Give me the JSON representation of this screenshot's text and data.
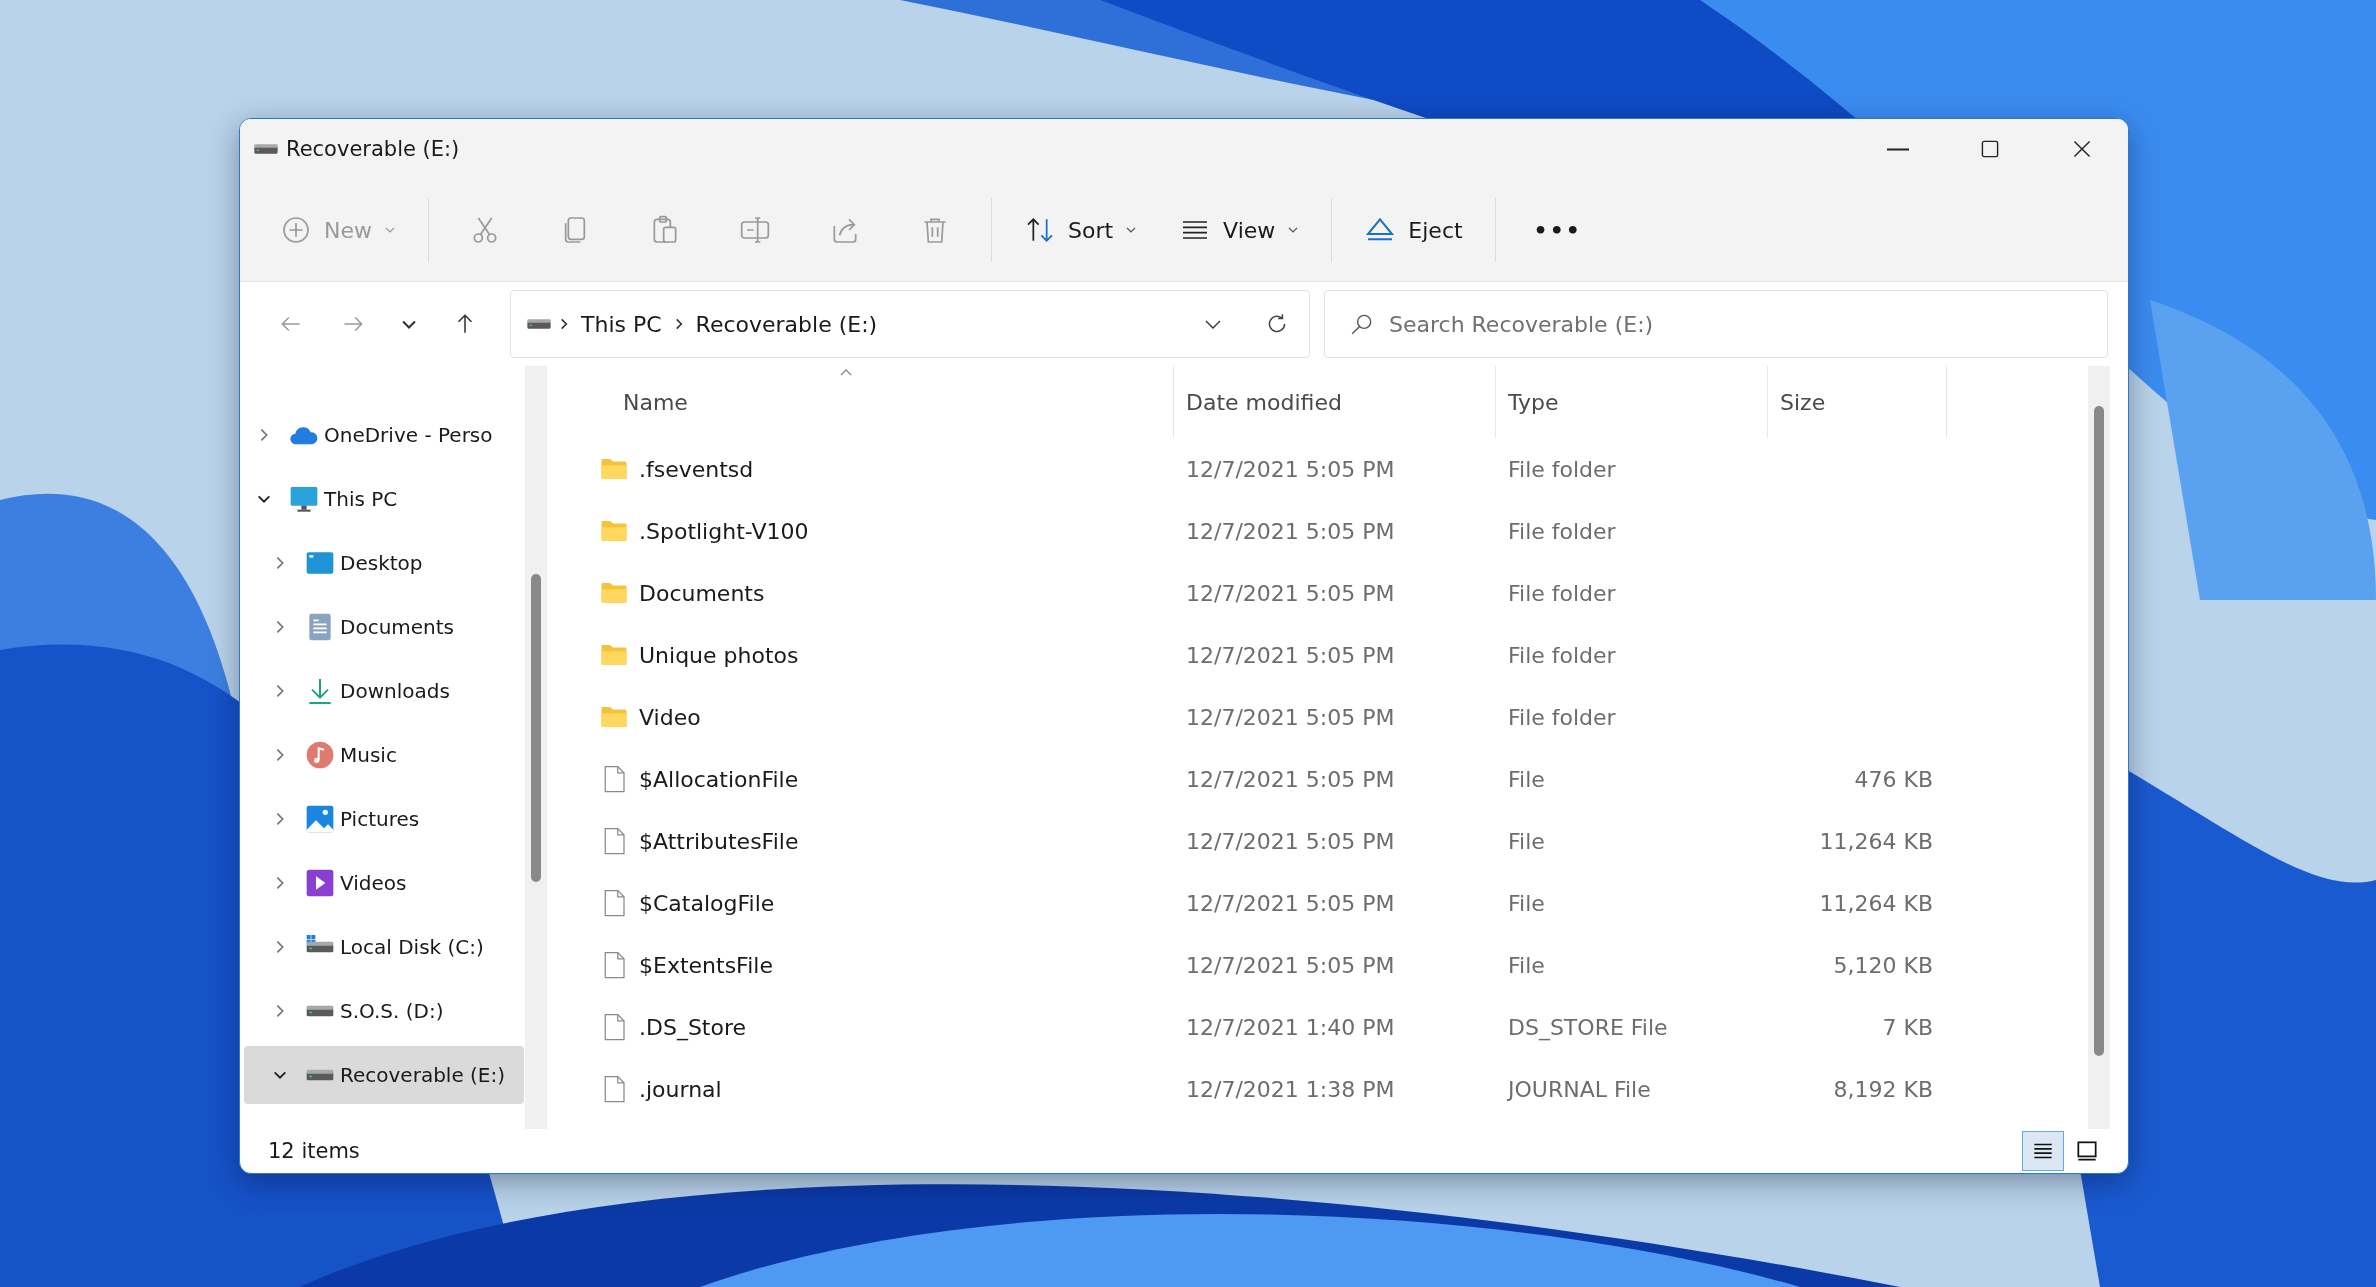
{
  "window": {
    "title": "Recoverable (E:)"
  },
  "toolbar": [
    {
      "kind": "new",
      "label": "New",
      "disabled": true,
      "dropdown": true
    },
    {
      "kind": "separator"
    },
    {
      "kind": "cut",
      "disabled": true
    },
    {
      "kind": "copy",
      "disabled": true
    },
    {
      "kind": "paste",
      "disabled": true
    },
    {
      "kind": "rename",
      "disabled": true
    },
    {
      "kind": "share",
      "disabled": true
    },
    {
      "kind": "delete",
      "disabled": true
    },
    {
      "kind": "separator"
    },
    {
      "kind": "sort",
      "label": "Sort",
      "disabled": false,
      "dropdown": true
    },
    {
      "kind": "view",
      "label": "View",
      "disabled": false,
      "dropdown": true
    },
    {
      "kind": "separator"
    },
    {
      "kind": "eject",
      "label": "Eject",
      "disabled": false,
      "dropdown": false
    },
    {
      "kind": "separator"
    },
    {
      "kind": "more",
      "label": "•••",
      "disabled": false
    }
  ],
  "navigation": {
    "back": {
      "disabled": true
    },
    "forward": {
      "disabled": true
    },
    "up": {
      "disabled": false
    },
    "breadcrumb": [
      "This PC",
      "Recoverable (E:)"
    ],
    "search": {
      "placeholder": "Search Recoverable (E:)"
    }
  },
  "sidebar": {
    "items": [
      {
        "label": "OneDrive - Perso",
        "kind": "cloud",
        "expanded": false,
        "selected": false
      },
      {
        "label": "This PC",
        "kind": "pc",
        "expanded": true,
        "selected": false,
        "children": [
          {
            "label": "Desktop",
            "kind": "desktop",
            "expanded": false,
            "selected": false
          },
          {
            "label": "Documents",
            "kind": "documents",
            "expanded": false,
            "selected": false
          },
          {
            "label": "Downloads",
            "kind": "downloads",
            "expanded": false,
            "selected": false
          },
          {
            "label": "Music",
            "kind": "music",
            "expanded": false,
            "selected": false
          },
          {
            "label": "Pictures",
            "kind": "pictures",
            "expanded": false,
            "selected": false
          },
          {
            "label": "Videos",
            "kind": "videos",
            "expanded": false,
            "selected": false
          },
          {
            "label": "Local Disk (C:)",
            "kind": "system-drive",
            "expanded": false,
            "selected": false
          },
          {
            "label": "S.O.S. (D:)",
            "kind": "drive",
            "expanded": false,
            "selected": false
          },
          {
            "label": "Recoverable (E:)",
            "kind": "drive",
            "expanded": true,
            "selected": true
          }
        ]
      }
    ]
  },
  "table": {
    "columns": [
      {
        "label": "Name",
        "sorted": true
      },
      {
        "label": "Date modified",
        "sorted": false
      },
      {
        "label": "Type",
        "sorted": false
      },
      {
        "label": "Size",
        "sorted": false
      }
    ],
    "rows": [
      {
        "kind": "folder",
        "name": ".fseventsd",
        "date": "12/7/2021 5:05 PM",
        "type": "File folder"
      },
      {
        "kind": "folder",
        "name": ".Spotlight-V100",
        "date": "12/7/2021 5:05 PM",
        "type": "File folder"
      },
      {
        "kind": "folder",
        "name": "Documents",
        "date": "12/7/2021 5:05 PM",
        "type": "File folder"
      },
      {
        "kind": "folder",
        "name": "Unique photos",
        "date": "12/7/2021 5:05 PM",
        "type": "File folder"
      },
      {
        "kind": "folder",
        "name": "Video",
        "date": "12/7/2021 5:05 PM",
        "type": "File folder"
      },
      {
        "kind": "file",
        "name": "$AllocationFile",
        "date": "12/7/2021 5:05 PM",
        "type": "File",
        "size": "476 KB"
      },
      {
        "kind": "file",
        "name": "$AttributesFile",
        "date": "12/7/2021 5:05 PM",
        "type": "File",
        "size": "11,264 KB"
      },
      {
        "kind": "file",
        "name": "$CatalogFile",
        "date": "12/7/2021 5:05 PM",
        "type": "File",
        "size": "11,264 KB"
      },
      {
        "kind": "file",
        "name": "$ExtentsFile",
        "date": "12/7/2021 5:05 PM",
        "type": "File",
        "size": "5,120 KB"
      },
      {
        "kind": "file",
        "name": ".DS_Store",
        "date": "12/7/2021 1:40 PM",
        "type": "DS_STORE File",
        "size": "7 KB"
      },
      {
        "kind": "file",
        "name": ".journal",
        "date": "12/7/2021 1:38 PM",
        "type": "JOURNAL File",
        "size": "8,192 KB"
      }
    ]
  },
  "status_bar": {
    "count": "12 items",
    "views": [
      {
        "kind": "details",
        "selected": true
      },
      {
        "kind": "tiles",
        "selected": false
      }
    ]
  }
}
